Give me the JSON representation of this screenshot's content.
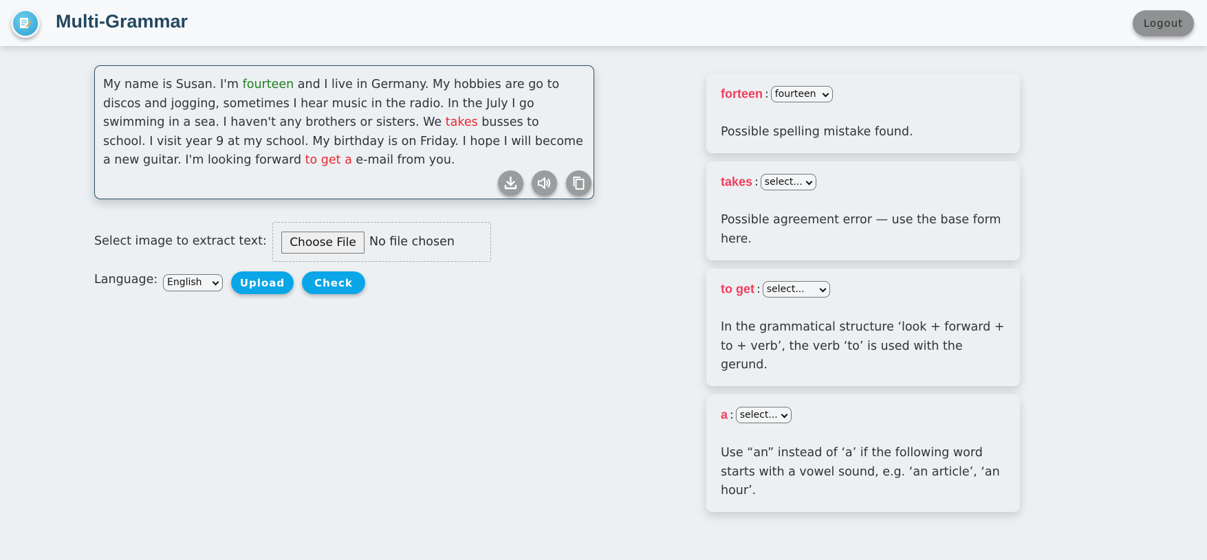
{
  "header": {
    "title": "Multi-Grammar",
    "logout_label": "Logout",
    "logo_icon": "document-edit-icon"
  },
  "editor": {
    "segments": [
      {
        "text": "My name is Susan. I'm ",
        "style": "normal"
      },
      {
        "text": "fourteen",
        "style": "corrected"
      },
      {
        "text": " and I live in Germany. My hobbies are go to discos and jogging, sometimes I hear music in the radio. In the July I go swimming in a sea. I haven't any brothers or sisters. We ",
        "style": "normal"
      },
      {
        "text": "takes",
        "style": "error"
      },
      {
        "text": " busses to school. I visit year 9 at my school. My birthday is on Friday. I hope I will become a new guitar. I'm looking forward ",
        "style": "normal"
      },
      {
        "text": "to get a",
        "style": "error"
      },
      {
        "text": " e-mail from you.",
        "style": "normal"
      }
    ],
    "tools": [
      "download-icon",
      "speaker-icon",
      "copy-icon"
    ]
  },
  "image_extract": {
    "label": "Select image to extract text:",
    "choose_label": "Choose File",
    "status": "No file chosen"
  },
  "language": {
    "label": "Language:",
    "selected": "English"
  },
  "buttons": {
    "upload": "Upload",
    "check": "Check"
  },
  "suggestions": [
    {
      "word": "forteen",
      "selected": "fourteen",
      "message": "Possible spelling mistake found."
    },
    {
      "word": "takes",
      "selected": "select...",
      "message": "Possible agreement error — use the base form here."
    },
    {
      "word": "to get",
      "selected": "select...",
      "message": "In the grammatical structure ‘look + forward + to + verb’, the verb ‘to’ is used with the gerund."
    },
    {
      "word": "a",
      "selected": "select...",
      "message": "Use “an” instead of ‘a’ if the following word starts with a vowel sound, e.g. ‘an article’, ‘an hour’."
    }
  ],
  "colors": {
    "accent": "#0aa6e8",
    "error": "#e8262f",
    "error_word": "#ef3e5b",
    "corrected": "#1f7d1f",
    "title": "#22485f"
  }
}
